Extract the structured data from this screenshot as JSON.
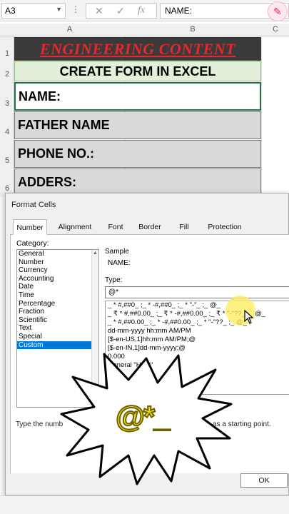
{
  "formula_bar": {
    "name_box": "A3",
    "fx_label": "fx",
    "content": "NAME:"
  },
  "columns": [
    "A",
    "B",
    "C"
  ],
  "rows": [
    "1",
    "2",
    "3",
    "4",
    "5",
    "6"
  ],
  "sheet": {
    "title": "ENGINEERING CONTENT",
    "subtitle": "CREATE FORM IN EXCEL",
    "fields": [
      "NAME:",
      "FATHER NAME",
      "PHONE NO.:",
      "ADDERS:"
    ]
  },
  "dialog": {
    "title": "Format Cells",
    "tabs": [
      "Number",
      "Alignment",
      "Font",
      "Border",
      "Fill",
      "Protection"
    ],
    "active_tab": "Number",
    "category_label": "Category:",
    "categories": [
      "General",
      "Number",
      "Currency",
      "Accounting",
      "Date",
      "Time",
      "Percentage",
      "Fraction",
      "Scientific",
      "Text",
      "Special",
      "Custom"
    ],
    "selected_category": "Custom",
    "sample_label": "Sample",
    "sample_value": "NAME:",
    "type_label": "Type:",
    "type_value": "@*",
    "format_list": [
      "_ * #,##0_ ;_ * -#,##0_ ;_ * \"-\"_ ;_ @_",
      "_ ₹ * #,##0.00_ ;_ ₹ * -#,##0.00_ ;_ ₹ * \"-\"??_ ;_ @_",
      "_ * #,##0.00_ ;_ * -#,##0.00_ ;_ * \"-\"??_ ;_ @_",
      "dd-mm-yyyy hh:mm AM/PM",
      "[$-en-US,1]hh:mm AM/PM;@",
      "[$-en-IN,1]dd-mm-yyyy;@",
      "0.000",
      "General \"HRS\"",
      "[$-..."
    ],
    "hint_left": "Type the numb",
    "hint_right": "s as a starting point.",
    "ok_label": "OK"
  },
  "overlay": {
    "burst_text": "@*_"
  },
  "colors": {
    "title_bg": "#3a3a3a",
    "title_fg": "#e8262e",
    "subtitle_bg": "#e2efda",
    "field_bg": "#d9d9d9",
    "selected_bg": "#0078d7",
    "burst_text": "#f6e218"
  }
}
